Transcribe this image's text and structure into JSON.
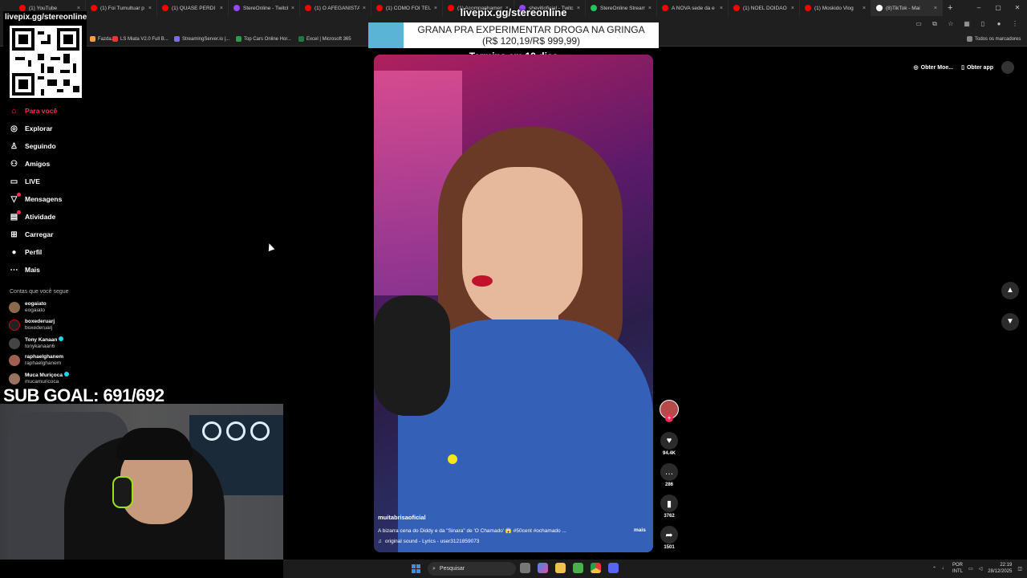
{
  "browser": {
    "tabs": [
      {
        "label": "(1) YouTube",
        "color": "#ff0000"
      },
      {
        "label": "(1) Foi Tumultuar p",
        "color": "#ff0000"
      },
      {
        "label": "(1) QUASE PERDI M",
        "color": "#ff0000"
      },
      {
        "label": "StereOnline - Twitch",
        "color": "#9146ff"
      },
      {
        "label": "(1) O AFEGANISTÃ",
        "color": "#ff0000"
      },
      {
        "label": "(1) COMO FOI TEU",
        "color": "#ff0000"
      },
      {
        "label": "(1) Acompanhamento",
        "color": "#ff0000"
      },
      {
        "label": "shevitioficial - Twitc",
        "color": "#9146ff"
      },
      {
        "label": "StereOnline Stream",
        "color": "#22c55e"
      },
      {
        "label": "A NOVA sede da e",
        "color": "#ff0000"
      },
      {
        "label": "(1) NOEL DOIDÃO",
        "color": "#ff0000"
      },
      {
        "label": "(1) Moskido Vlog",
        "color": "#ff0000"
      },
      {
        "label": "(8)TikTok - Mai",
        "color": "#ffffff"
      }
    ],
    "new_tab": "+",
    "window_controls": [
      "–",
      "▢",
      "✕"
    ],
    "bookmarks": [
      {
        "label": "Fazda...",
        "color": "#f2a03a"
      },
      {
        "label": "LS Miata V2.0 Full B...",
        "color": "#e33"
      },
      {
        "label": "StreamingServer.io |...",
        "color": "#7a6cf0"
      },
      {
        "label": "Top Cars Online Hor...",
        "color": "#2a9d4a"
      },
      {
        "label": "Excel | Microsoft 365",
        "color": "#1e7a45"
      },
      {
        "label": "Todos os marcadores",
        "color": "#888"
      }
    ]
  },
  "overlay": {
    "qr_title": "livepix.gg/stereonline",
    "url": "livepix.gg/stereonline",
    "donation_line1": "GRANA PRA EXPERIMENTAR DROGA NA GRINGA",
    "donation_line2": "(R$ 120,19/R$ 999,99)",
    "ends": "Termina em 19 dias",
    "sub_goal": "SUB GOAL: 691/692"
  },
  "nav": {
    "items": [
      {
        "label": "Para você",
        "icon": "home-icon",
        "glyph": "⌂"
      },
      {
        "label": "Explorar",
        "icon": "compass-icon",
        "glyph": "◎"
      },
      {
        "label": "Seguindo",
        "icon": "user-icon",
        "glyph": "♙"
      },
      {
        "label": "Amigos",
        "icon": "friends-icon",
        "glyph": "⚇"
      },
      {
        "label": "LIVE",
        "icon": "live-icon",
        "glyph": "▭"
      },
      {
        "label": "Mensagens",
        "icon": "message-icon",
        "glyph": "▽"
      },
      {
        "label": "Atividade",
        "icon": "activity-icon",
        "glyph": "▤"
      },
      {
        "label": "Carregar",
        "icon": "upload-icon",
        "glyph": "⊞"
      },
      {
        "label": "Perfil",
        "icon": "profile-icon",
        "glyph": "●"
      },
      {
        "label": "Mais",
        "icon": "more-icon",
        "glyph": "⋯"
      }
    ],
    "follows_title": "Contas que você segue",
    "follows": [
      {
        "name": "eogaiato",
        "handle": "eogaiato",
        "verified": false
      },
      {
        "name": "boxederuarj",
        "handle": "boxederuarj",
        "verified": false
      },
      {
        "name": "Tony Kanaan",
        "handle": "tonykanaan6",
        "verified": true
      },
      {
        "name": "raphaelghanem",
        "handle": "raphaelghanem",
        "verified": false
      },
      {
        "name": "Muca Muriçoca",
        "handle": "mucamuricoca",
        "verified": true
      }
    ]
  },
  "video": {
    "author": "muitabrisaoficial",
    "description": "A bizarra cena do Diddy e da \"Sinara\" de 'O Chamado' 😱 #50cent #ochamado ...",
    "more": "mais",
    "sound": "original sound - Lyrics - user3121859073"
  },
  "actions": {
    "likes": "94.4K",
    "comments": "286",
    "saves": "3762",
    "shares": "1501"
  },
  "tiktok_top": {
    "coins": "Obter Moe...",
    "app": "Obter app"
  },
  "taskbar": {
    "search_placeholder": "Pesquisar",
    "lang1": "POR",
    "lang2": "INTL",
    "time": "22:19",
    "date": "28/12/2025"
  }
}
